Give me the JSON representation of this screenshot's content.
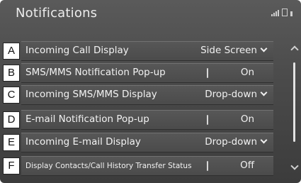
{
  "header": {
    "title": "Notifications"
  },
  "rows": [
    {
      "key": "A",
      "label": "Incoming Call Display",
      "value": "Side Screen",
      "type": "dropdown"
    },
    {
      "key": "B",
      "label": "SMS/MMS Notification Pop-up",
      "value": "On",
      "type": "toggle"
    },
    {
      "key": "C",
      "label": "Incoming SMS/MMS Display",
      "value": "Drop-down",
      "type": "dropdown"
    },
    {
      "key": "D",
      "label": "E-mail Notification Pop-up",
      "value": "On",
      "type": "toggle"
    },
    {
      "key": "E",
      "label": "Incoming E-mail Display",
      "value": "Drop-down",
      "type": "dropdown"
    },
    {
      "key": "F",
      "label": "Display Contacts/Call History Transfer Status",
      "value": "Off",
      "type": "toggle"
    }
  ],
  "icons": {
    "status": [
      "signal-icon",
      "battery-icon",
      "status-indicator-icon"
    ],
    "scroll_up": "chevron-up-icon",
    "scroll_down": "chevron-down-icon"
  },
  "colors": {
    "background": "#4a4a4a",
    "text": "#f0f0f0",
    "callout_bg": "#ffffff"
  }
}
